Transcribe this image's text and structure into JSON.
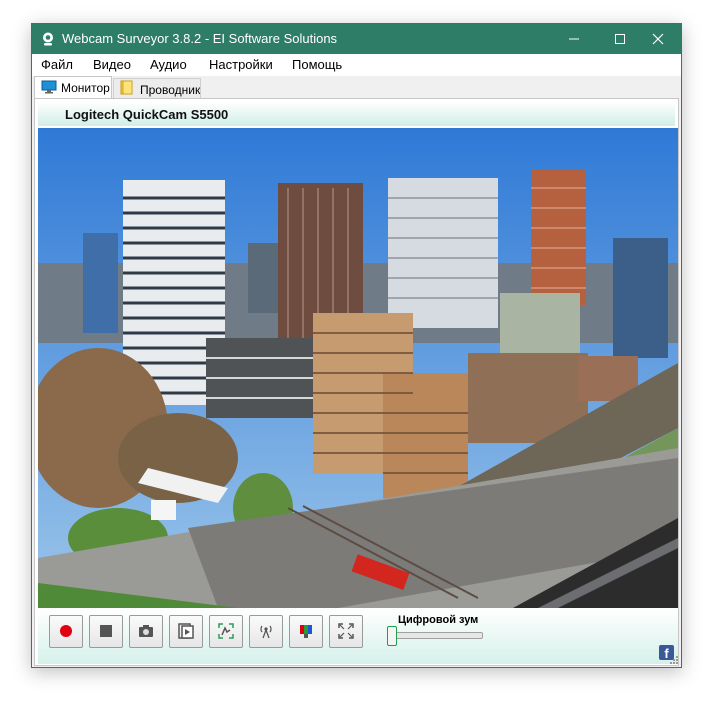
{
  "window": {
    "title": "Webcam Surveyor 3.8.2 - EI Software Solutions",
    "titlebar_color": "#2e7d66"
  },
  "menu": [
    "Файл",
    "Видео",
    "Аудио",
    "Настройки",
    "Помощь"
  ],
  "tabs": [
    {
      "label": "Монитор",
      "icon": "monitor-icon",
      "active": true
    },
    {
      "label": "Проводник",
      "icon": "folder-icon",
      "active": false
    }
  ],
  "camera": {
    "name": "Logitech QuickCam S5500"
  },
  "controls": {
    "buttons": [
      "record-icon",
      "stop-icon",
      "camera-icon",
      "play-icon",
      "motion-detect-icon",
      "broadcast-icon",
      "color-settings-icon",
      "fullscreen-icon"
    ],
    "zoom_label": "Цифровой зум",
    "zoom_level": 0,
    "record_color": "#e0000f"
  },
  "facebook": {
    "label": "f"
  }
}
